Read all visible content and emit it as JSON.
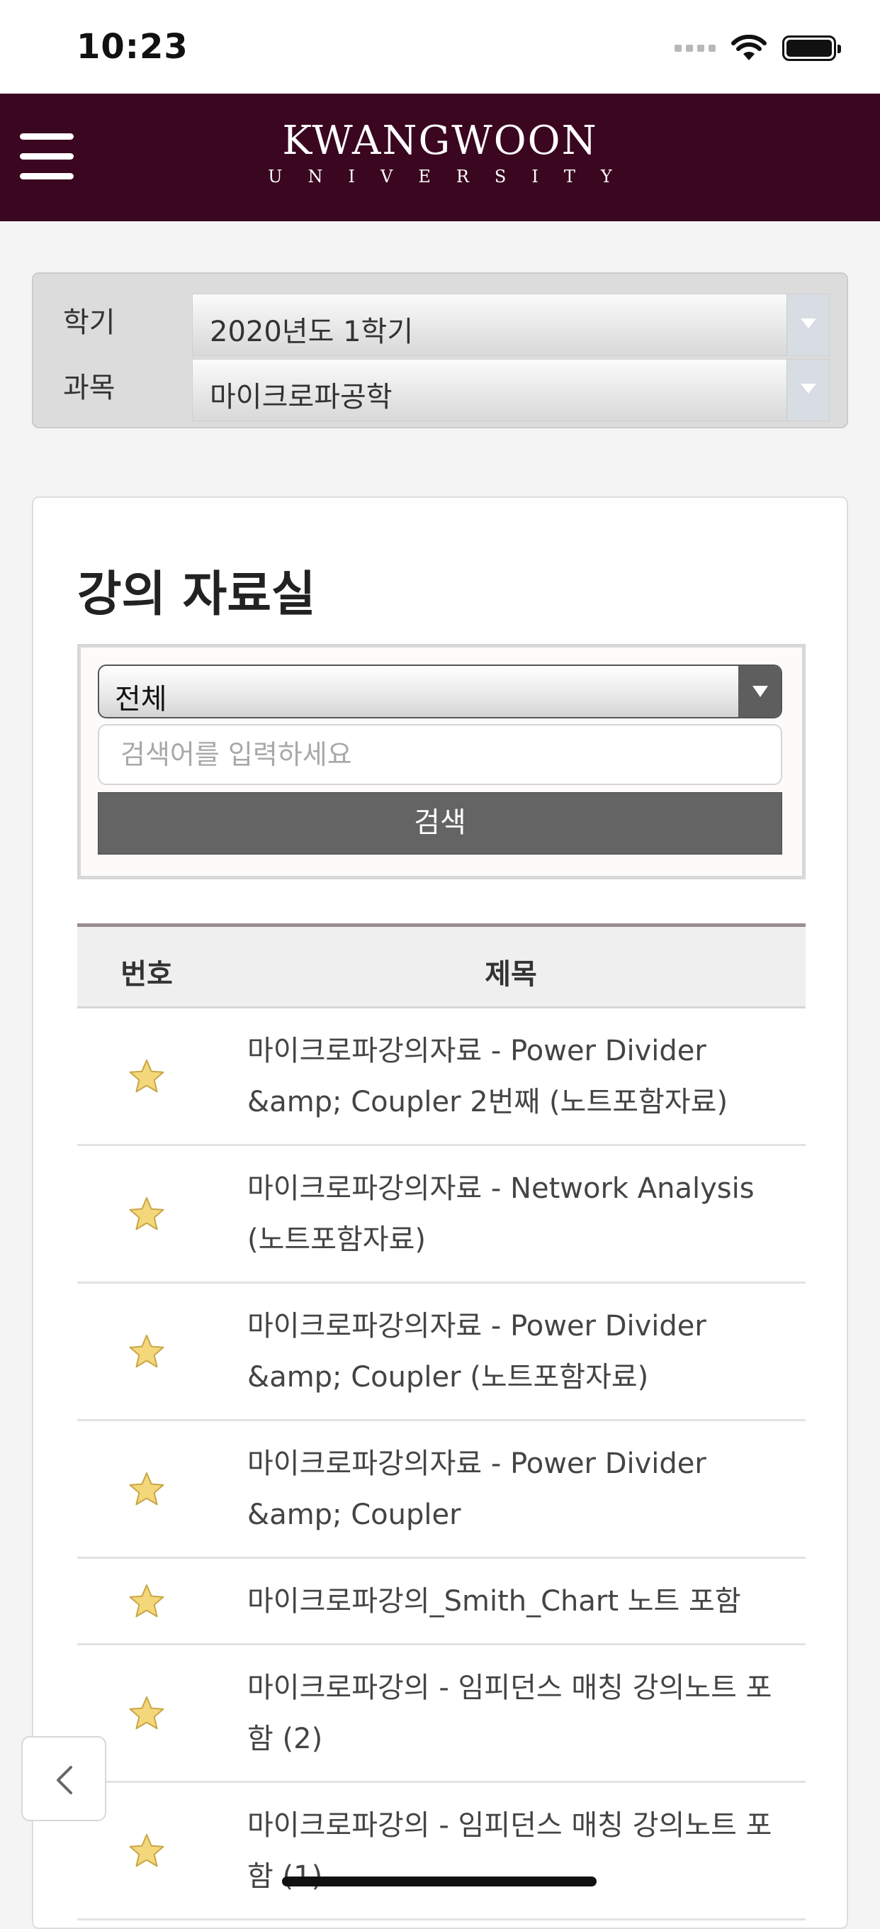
{
  "status_bar": {
    "time": "10:23"
  },
  "header": {
    "logo_main": "KWANGWOON",
    "logo_sub": "UNIVERSITY"
  },
  "selectors": {
    "semester_label": "학기",
    "semester_value": "2020년도 1학기",
    "subject_label": "과목",
    "subject_value": "마이크로파공학"
  },
  "page": {
    "title": "강의 자료실"
  },
  "search": {
    "category_value": "전체",
    "placeholder": "검색어를 입력하세요",
    "button_label": "검색"
  },
  "table": {
    "headers": {
      "number": "번호",
      "title": "제목"
    },
    "rows": [
      {
        "title": "마이크로파강의자료 - Power Divider &amp; Coupler 2번째 (노트포함자료)"
      },
      {
        "title": "마이크로파강의자료 - Network Analysis (노트포함자료)"
      },
      {
        "title": "마이크로파강의자료 - Power Divider &amp; Coupler (노트포함자료)"
      },
      {
        "title": "마이크로파강의자료 - Power Divider &amp; Coupler"
      },
      {
        "title": "마이크로파강의_Smith_Chart 노트 포함"
      },
      {
        "title": "마이크로파강의 - 임피던스 매칭 강의노트 포함 (2)"
      },
      {
        "title": "마이크로파강의 - 임피던스 매칭 강의노트 포함 (1)"
      }
    ]
  },
  "colors": {
    "brand": "#3a0620",
    "star": "#f3d77a",
    "button": "#646464"
  },
  "icons": {
    "menu": "hamburger-menu-icon",
    "row": "star-icon",
    "back": "chevron-left-icon",
    "dropdown": "triangle-down-icon"
  }
}
